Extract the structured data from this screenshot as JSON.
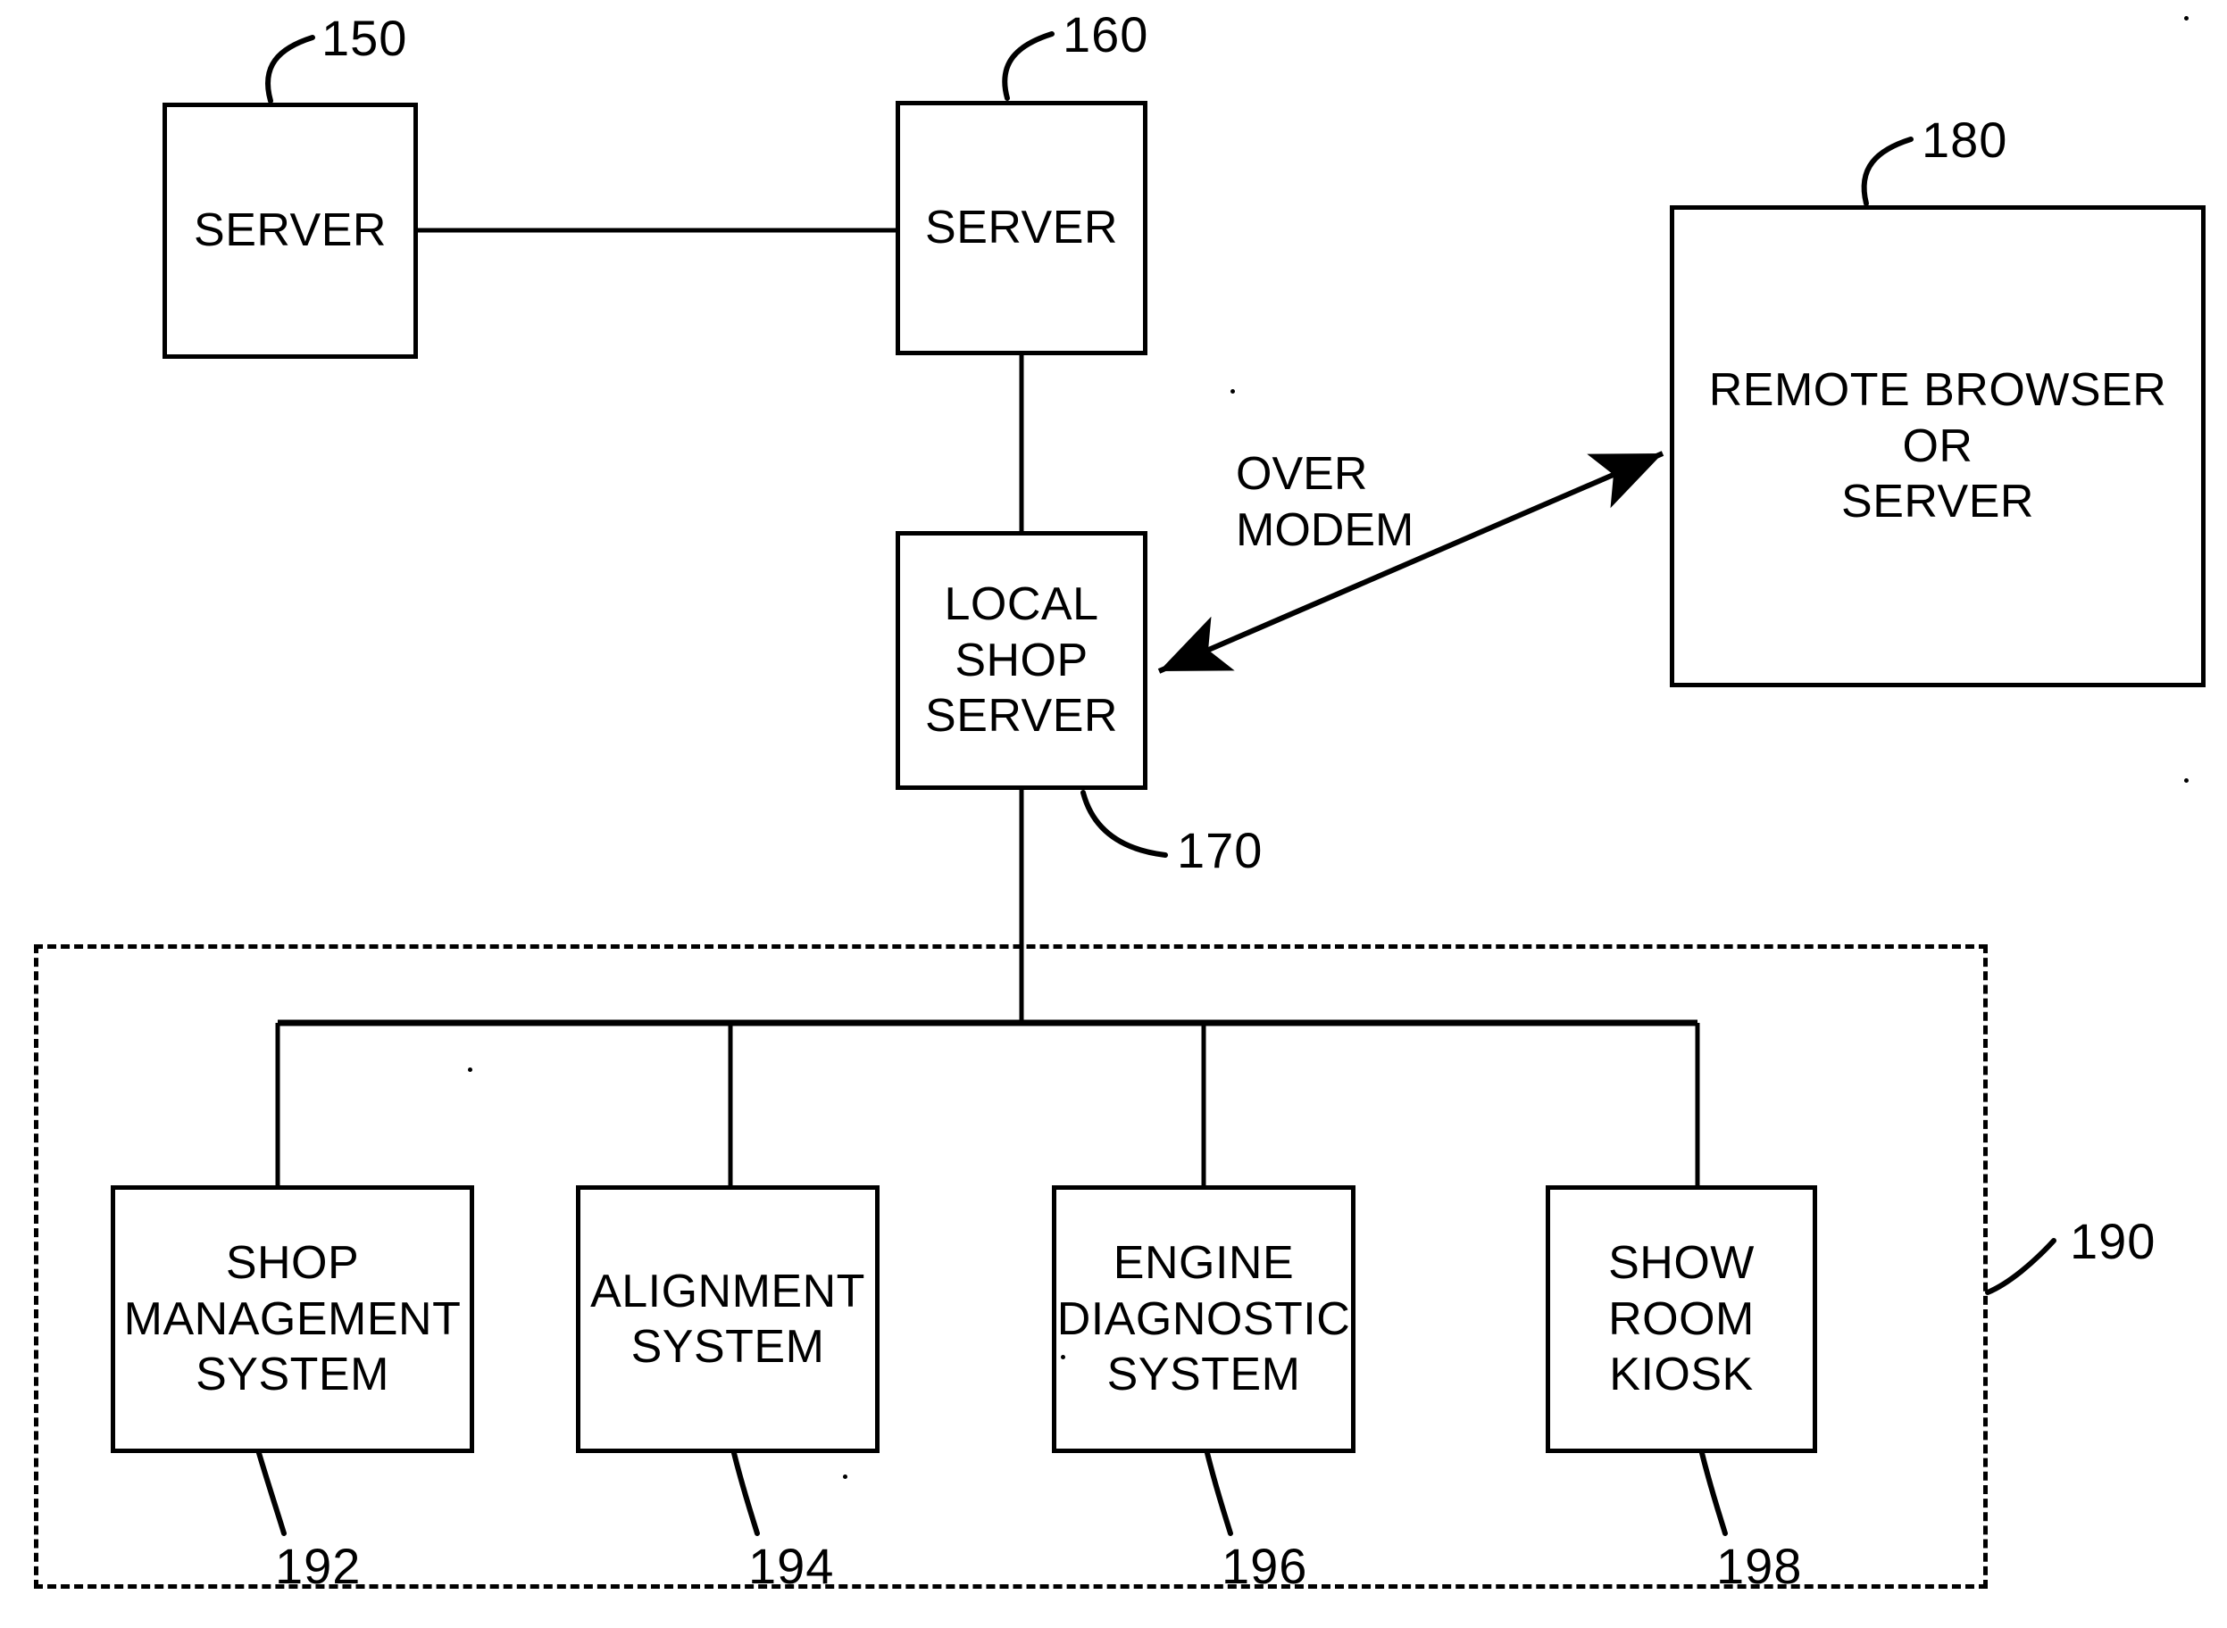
{
  "figure": {
    "type": "patent-block-diagram",
    "background_color": "#ffffff",
    "line_color": "#000000"
  },
  "nodes": [
    {
      "id": "server_150",
      "label": "SERVER",
      "ref": "150"
    },
    {
      "id": "server_160",
      "label": "SERVER",
      "ref": "160"
    },
    {
      "id": "remote_180",
      "label": "REMOTE BROWSER\nOR\nSERVER",
      "ref": "180"
    },
    {
      "id": "local_170",
      "label": "LOCAL\nSHOP\nSERVER",
      "ref": "170"
    },
    {
      "id": "shop_192",
      "label": "SHOP\nMANAGEMENT\nSYSTEM",
      "ref": "192"
    },
    {
      "id": "align_194",
      "label": "ALIGNMENT\nSYSTEM",
      "ref": "194"
    },
    {
      "id": "engine_196",
      "label": "ENGINE\nDIAGNOSTIC\nSYSTEM",
      "ref": "196"
    },
    {
      "id": "kiosk_198",
      "label": "SHOW\nROOM\nKIOSK",
      "ref": "198"
    }
  ],
  "regions": [
    {
      "id": "shop_network_190",
      "label": "",
      "ref": "190",
      "style": "dashed"
    }
  ],
  "edges": [
    {
      "from": "server_150",
      "to": "server_160",
      "label": "",
      "arrows": "none"
    },
    {
      "from": "server_160",
      "to": "local_170",
      "label": "",
      "arrows": "none"
    },
    {
      "from": "local_170",
      "to": "remote_180",
      "label": "OVER\nMODEM",
      "arrows": "both"
    },
    {
      "from": "local_170",
      "to": "shop_network_190",
      "label": "",
      "arrows": "none"
    },
    {
      "from": "bus",
      "to": "shop_192",
      "label": "",
      "arrows": "none"
    },
    {
      "from": "bus",
      "to": "align_194",
      "label": "",
      "arrows": "none"
    },
    {
      "from": "bus",
      "to": "engine_196",
      "label": "",
      "arrows": "none"
    },
    {
      "from": "bus",
      "to": "kiosk_198",
      "label": "",
      "arrows": "none"
    }
  ],
  "edge_labels": {
    "over_modem": "OVER\nMODEM"
  },
  "ref_numbers": {
    "server_150": "150",
    "server_160": "160",
    "remote_180": "180",
    "local_170": "170",
    "region_190": "190",
    "shop_192": "192",
    "align_194": "194",
    "engine_196": "196",
    "kiosk_198": "198"
  },
  "node_labels": {
    "server_150": "SERVER",
    "server_160": "SERVER",
    "remote_180": "REMOTE BROWSER\nOR\nSERVER",
    "local_170": "LOCAL\nSHOP\nSERVER",
    "shop_192": "SHOP\nMANAGEMENT\nSYSTEM",
    "align_194": "ALIGNMENT\nSYSTEM",
    "engine_196": "ENGINE\nDIAGNOSTIC\nSYSTEM",
    "kiosk_198": "SHOW\nROOM\nKIOSK"
  }
}
